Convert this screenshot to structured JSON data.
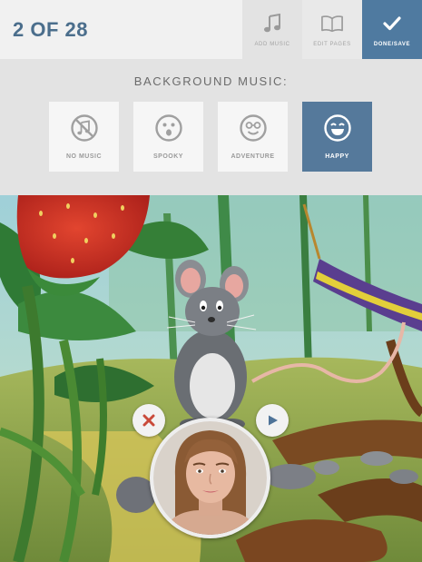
{
  "header": {
    "page_counter": "2 OF 28",
    "add_music_label": "ADD MUSIC",
    "edit_pages_label": "EDIT PAGES",
    "done_save_label": "DONE/SAVE"
  },
  "music_panel": {
    "title": "BACKGROUND MUSIC:",
    "options": [
      {
        "label": "NO MUSIC",
        "icon": "no-music-icon",
        "selected": false
      },
      {
        "label": "SPOOKY",
        "icon": "spooky-face-icon",
        "selected": false
      },
      {
        "label": "ADVENTURE",
        "icon": "adventure-face-icon",
        "selected": false
      },
      {
        "label": "HAPPY",
        "icon": "happy-face-icon",
        "selected": true
      }
    ]
  },
  "colors": {
    "accent": "#4f7aa0",
    "selected_card": "#55799b",
    "cancel_red": "#c94a3a",
    "play_blue": "#4e7398"
  }
}
